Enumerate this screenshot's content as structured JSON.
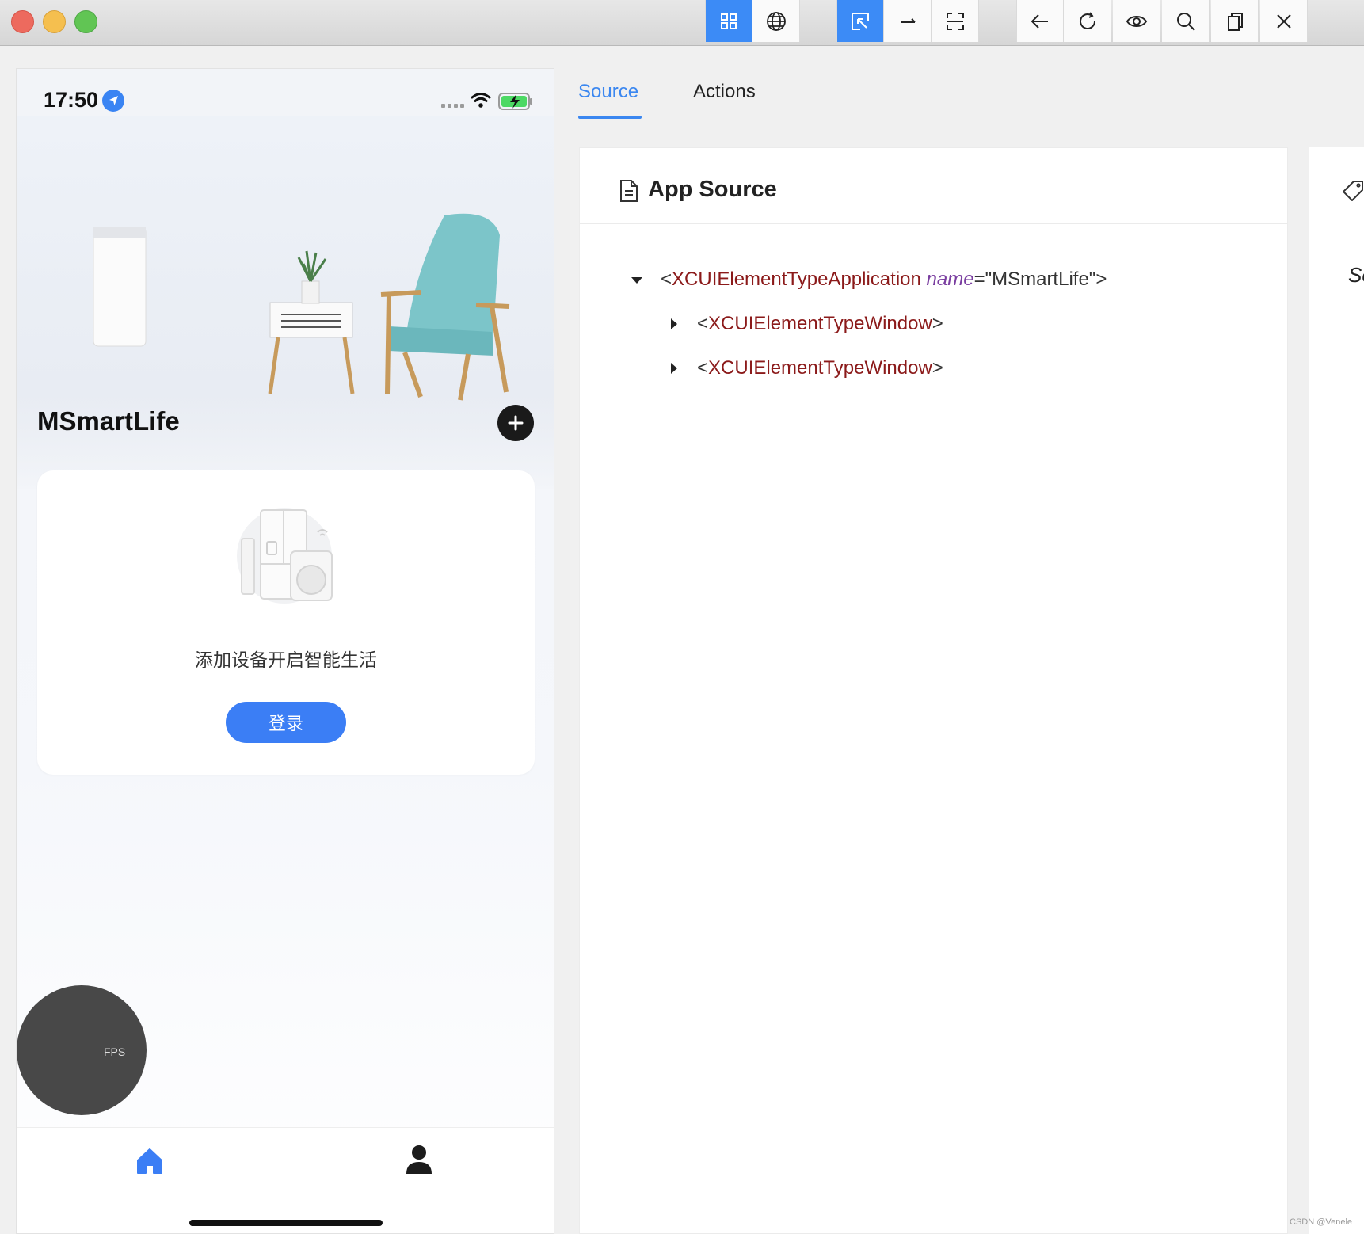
{
  "toolbar": {
    "buttons": [
      {
        "name": "grid-view",
        "active": true
      },
      {
        "name": "web-view",
        "active": false
      },
      {
        "name": "select-element",
        "active": true
      },
      {
        "name": "swipe",
        "active": false
      },
      {
        "name": "tap-coordinates",
        "active": false
      },
      {
        "name": "back",
        "active": false
      },
      {
        "name": "refresh",
        "active": false
      },
      {
        "name": "search-recorder",
        "active": false
      },
      {
        "name": "search",
        "active": false
      },
      {
        "name": "copy",
        "active": false
      },
      {
        "name": "close",
        "active": false
      }
    ]
  },
  "phone": {
    "status_time": "17:50",
    "app_name": "MSmartLife",
    "card_text": "添加设备开启智能生活",
    "login_label": "登录",
    "fps_label": "FPS"
  },
  "inspector": {
    "tabs": [
      {
        "label": "Source"
      },
      {
        "label": "Actions"
      }
    ],
    "panel_title": "App Source",
    "tree": {
      "root_tag": "XCUIElementTypeApplication",
      "root_attr_name": "name",
      "root_attr_value": "\"MSmartLife\"",
      "children": [
        {
          "tag": "XCUIElementTypeWindow"
        },
        {
          "tag": "XCUIElementTypeWindow"
        }
      ]
    },
    "side_panel_text": "Se"
  },
  "watermark": "CSDN @Venele",
  "colors": {
    "accent": "#3b87f0",
    "tag": "#8b1a1a",
    "attr": "#7a3ea0",
    "login_button": "#3b7ef5"
  }
}
